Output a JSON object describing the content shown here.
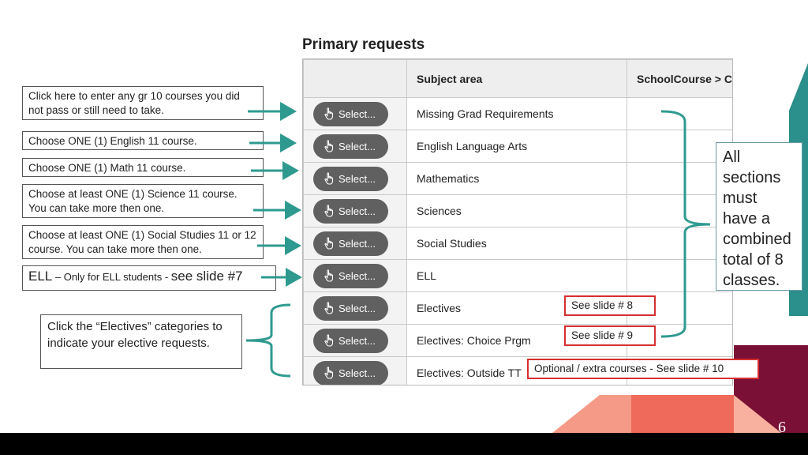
{
  "title": "Primary requests",
  "table": {
    "columns": [
      "",
      "Subject area",
      "SchoolCourse > Cr"
    ],
    "select_label": "Select...",
    "rows": [
      "Missing Grad Requirements",
      "English Language Arts",
      "Mathematics",
      "Sciences",
      "Social Studies",
      "ELL",
      "Electives",
      "Electives: Choice Prgm",
      "Electives: Outside TT"
    ]
  },
  "callouts": {
    "grade10": "Click here to enter any gr 10 courses you did not pass or still need to take.",
    "english": "Choose ONE (1) English 11 course.",
    "math": "Choose ONE (1) Math 11 course.",
    "science": "Choose at least ONE (1) Science 11 course. You can take more then one.",
    "social": "Choose at least ONE (1) Social Studies 11 or 12 course.  You can take more then one.",
    "ell_prefix": "ELL",
    "ell_mid": " – Only for ELL students - ",
    "ell_suffix": "see slide #7",
    "electives": "Click the “Electives” categories to indicate your elective requests.",
    "all_sections": "All sections must have a combined total of 8 classes."
  },
  "notes": {
    "slide8": "See slide # 8",
    "slide9": "See slide # 9",
    "slide10": "Optional / extra courses - See slide # 10"
  },
  "slide_number": "6",
  "colors": {
    "arrow": "#2e9a8f",
    "note_border": "#d62f2f",
    "select_button": "#606060",
    "maroon": "#7a1035",
    "salmon": "#f27a6c",
    "teal": "#2b8f8b"
  }
}
